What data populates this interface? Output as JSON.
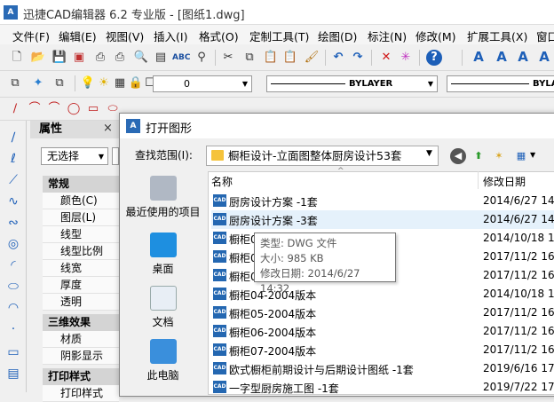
{
  "app": {
    "logo": "A",
    "title": "迅捷CAD编辑器 6.2 专业版 - [图纸1.dwg]"
  },
  "menu": [
    "文件(F)",
    "编辑(E)",
    "视图(V)",
    "插入(I)",
    "格式(O)",
    "定制工具(T)",
    "绘图(D)",
    "标注(N)",
    "修改(M)",
    "扩展工具(X)",
    "窗口"
  ],
  "layer": {
    "value": "0"
  },
  "linetype": {
    "value": "BYLAYER"
  },
  "lineweight": {
    "value": "BYLA"
  },
  "properties": {
    "title": "属性",
    "close": "×",
    "selection": "无选择",
    "groups": [
      {
        "label": "常规",
        "items": [
          "颜色(C)",
          "图层(L)",
          "线型",
          "线型比例",
          "线宽",
          "厚度",
          "透明"
        ]
      },
      {
        "label": "三维效果",
        "items": [
          "材质",
          "阴影显示"
        ]
      },
      {
        "label": "打印样式",
        "items": [
          "打印样式"
        ]
      }
    ]
  },
  "dialog": {
    "logo": "A",
    "title": "打开图形",
    "lookin_label": "查找范围(I):",
    "lookin_value": "橱柜设计-立面图整体厨房设计53套",
    "places": [
      {
        "label": "最近使用的项目",
        "icon": "recent-icon"
      },
      {
        "label": "桌面",
        "icon": "desktop-icon"
      },
      {
        "label": "文档",
        "icon": "documents-icon"
      },
      {
        "label": "此电脑",
        "icon": "computer-icon"
      }
    ],
    "columns": {
      "name": "名称",
      "date": "修改日期"
    },
    "file_icon_text": "CAD",
    "files": [
      {
        "name": "厨房设计方案 -1套",
        "date": "2014/6/27 14"
      },
      {
        "name": "厨房设计方案 -3套",
        "date": "2014/6/27 14"
      },
      {
        "name": "橱柜0",
        "date": "2014/10/18 13"
      },
      {
        "name": "橱柜0",
        "date": "2017/11/2 16:"
      },
      {
        "name": "橱柜0",
        "date": "2017/11/2 16:"
      },
      {
        "name": "橱柜04-2004版本",
        "date": "2014/10/18 13"
      },
      {
        "name": "橱柜05-2004版本",
        "date": "2017/11/2 16:"
      },
      {
        "name": "橱柜06-2004版本",
        "date": "2017/11/2 16:"
      },
      {
        "name": "橱柜07-2004版本",
        "date": "2017/11/2 16:"
      },
      {
        "name": "欧式橱柜前期设计与后期设计图纸 -1套",
        "date": "2019/6/16 17:"
      },
      {
        "name": "一字型厨房施工图 -1套",
        "date": "2019/7/22 17:"
      }
    ],
    "selected_index": 1,
    "tooltip": {
      "type": "类型: DWG 文件",
      "size": "大小: 985 KB",
      "modified": "修改日期: 2014/6/27 14:32"
    }
  }
}
